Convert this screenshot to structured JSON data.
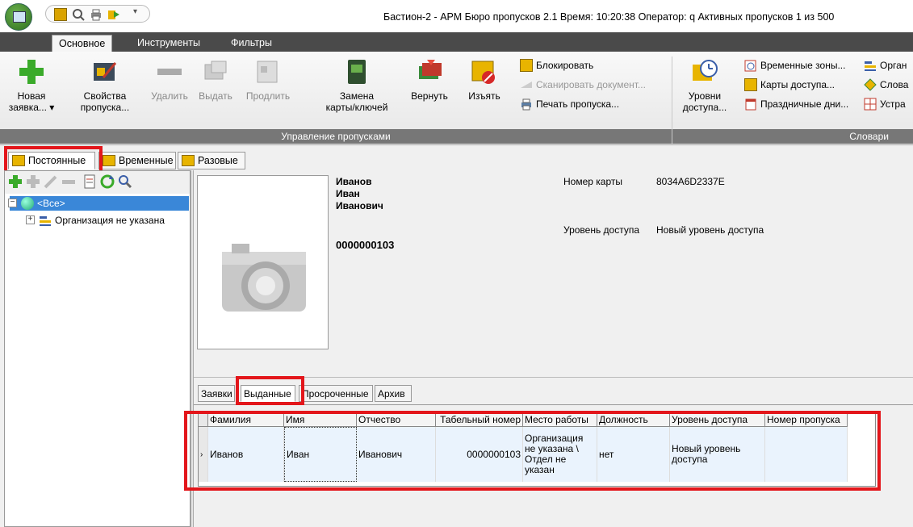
{
  "title": "Бастион-2 - АРМ Бюро пропусков 2.1 Время: 10:20:38 Оператор: q  Активных пропусков 1 из 500",
  "ribbon_tabs": [
    "Основное",
    "Инструменты",
    "Фильтры"
  ],
  "ribbon": {
    "new_request": "Новая заявка... ▾",
    "new_request_l1": "Новая",
    "new_request_l2": "заявка... ▾",
    "props_l1": "Свойства",
    "props_l2": "пропуска...",
    "delete": "Удалить",
    "issue": "Выдать",
    "extend": "Продлить",
    "replace_l1": "Замена",
    "replace_l2": "карты/ключей",
    "return": "Вернуть",
    "withdraw": "Изъять",
    "block": "Блокировать",
    "scan": "Сканировать документ...",
    "print": "Печать пропуска...",
    "group_manage": "Управление пропусками",
    "access_l1": "Уровни",
    "access_l2": "доступа...",
    "time_zones": "Временные зоны...",
    "access_cards": "Карты доступа...",
    "holidays": "Праздничные дни...",
    "org": "Орган",
    "dict": "Слова",
    "devices": "Устра",
    "group_dicts": "Словари"
  },
  "pass_tabs": [
    "Постоянные",
    "Временные",
    "Разовые"
  ],
  "tree": {
    "root": "<Все>",
    "child": "Организация не указана"
  },
  "person": {
    "last_name": "Иванов",
    "first_name": "Иван",
    "middle_name": "Иванович",
    "number": "0000000103",
    "card_label": "Номер карты",
    "card_value": "8034A6D2337E",
    "access_label": "Уровень доступа",
    "access_value": "Новый уровень доступа"
  },
  "sub_tabs": [
    "Заявки",
    "Выданные",
    "Просроченные",
    "Архив"
  ],
  "grid": {
    "columns": [
      "Фамилия",
      "Имя",
      "Отчество",
      "Табельный номер",
      "Место работы",
      "Должность",
      "Уровень доступа",
      "Номер пропуска"
    ],
    "row": {
      "last": "Иванов",
      "first": "Иван",
      "middle": "Иванович",
      "tab_no": "0000000103",
      "workplace": "Организация не указана \\ Отдел не указан",
      "position": "нет",
      "access": "Новый уровень доступа",
      "pass_no": ""
    }
  },
  "colors": {
    "highlight_red": "#e3161b",
    "selection_blue": "#3a87d8"
  }
}
